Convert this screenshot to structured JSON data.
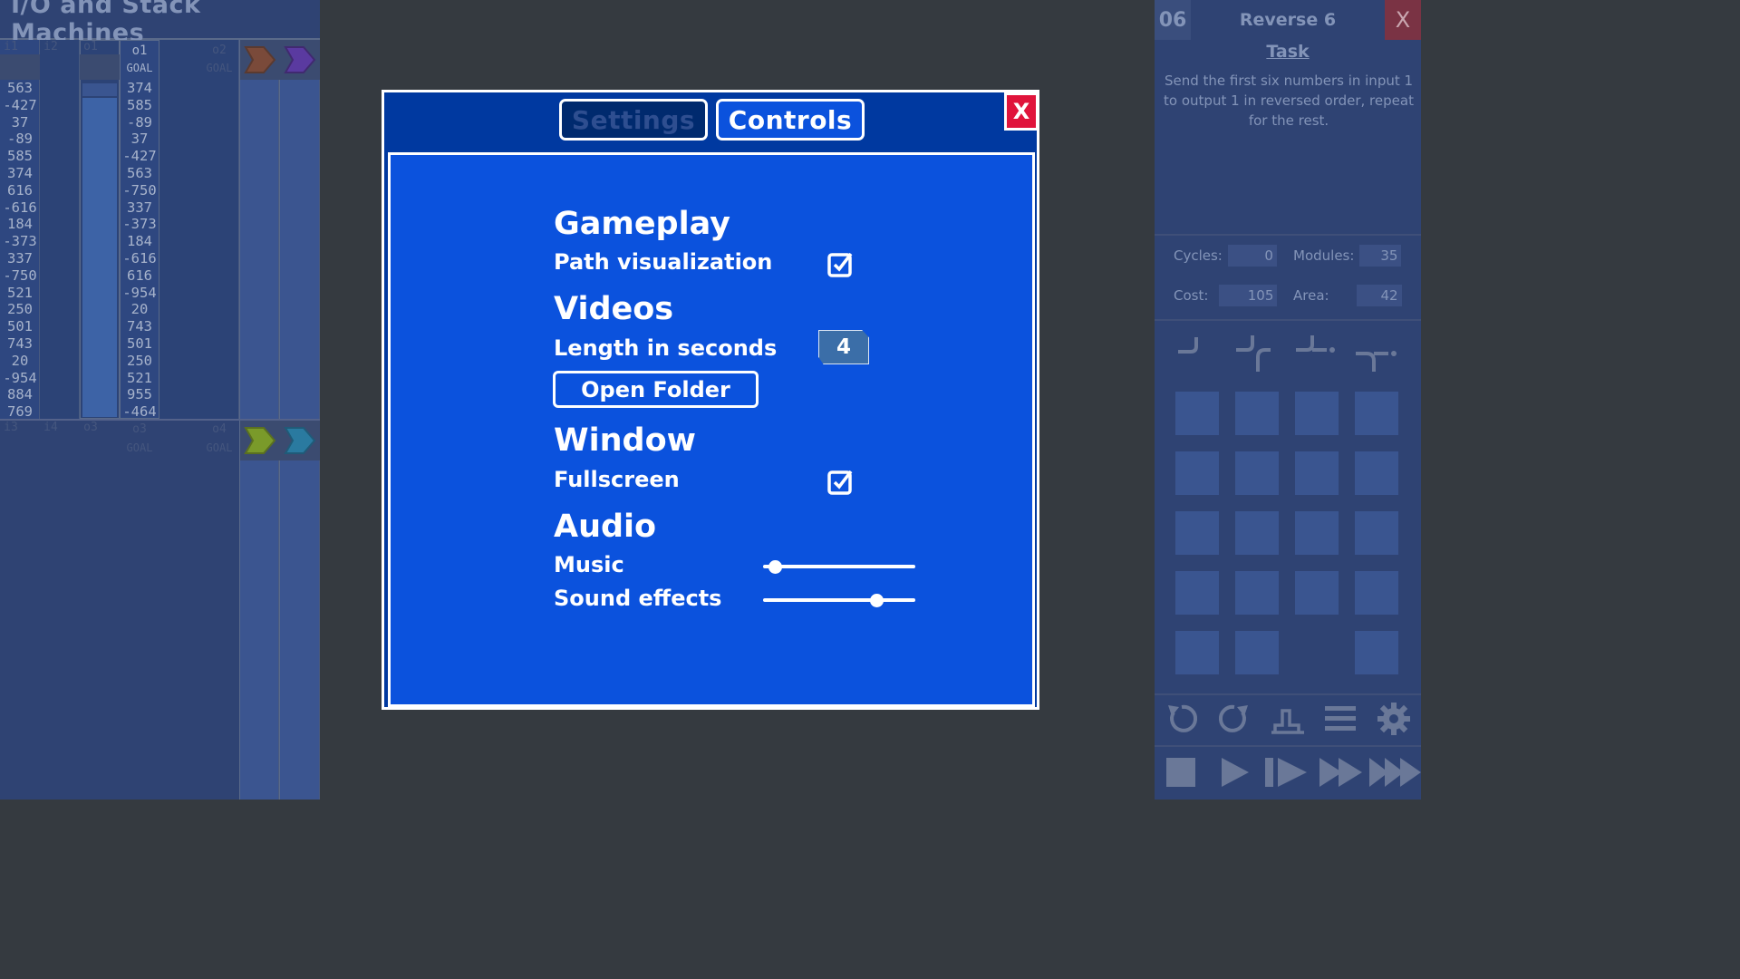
{
  "left_panel": {
    "title": "I/O and Stack Machines",
    "top_headers": [
      {
        "label": "i1",
        "sub": ""
      },
      {
        "label": "i2",
        "sub": ""
      },
      {
        "label": "o1",
        "sub": ""
      },
      {
        "label": "o1",
        "sub": "GOAL"
      },
      {
        "label": "o2",
        "sub": "GOAL"
      }
    ],
    "bottom_headers": [
      {
        "label": "i3",
        "sub": ""
      },
      {
        "label": "i4",
        "sub": ""
      },
      {
        "label": "o3",
        "sub": ""
      },
      {
        "label": "o3",
        "sub": "GOAL"
      },
      {
        "label": "o4",
        "sub": "GOAL"
      }
    ],
    "input1": [
      "563",
      "-427",
      "37",
      "-89",
      "585",
      "374",
      "616",
      "-616",
      "184",
      "-373",
      "337",
      "-750",
      "521",
      "250",
      "501",
      "743",
      "20",
      "-954",
      "884",
      "769"
    ],
    "goal1": [
      "374",
      "585",
      "-89",
      "37",
      "-427",
      "563",
      "-750",
      "337",
      "-373",
      "184",
      "-616",
      "616",
      "-954",
      "20",
      "743",
      "501",
      "250",
      "521",
      "955",
      "-464"
    ],
    "arrow_colors": [
      "#7a4a3a",
      "#5a3aa0",
      "#7a9a2a",
      "#2a7aa0"
    ]
  },
  "level": {
    "number": "06",
    "name": "Reverse 6",
    "close_label": "X",
    "task_title": "Task",
    "task_text": "Send the first six numbers in input 1 to output 1 in reversed order, repeat for the rest."
  },
  "stats": {
    "cycles_label": "Cycles:",
    "cycles": "0",
    "modules_label": "Modules:",
    "modules": "35",
    "cost_label": "Cost:",
    "cost": "105",
    "area_label": "Area:",
    "area": "42"
  },
  "modal": {
    "tab_settings": "Settings",
    "tab_controls": "Controls",
    "close_label": "X",
    "gameplay_title": "Gameplay",
    "path_visualization": "Path visualization",
    "path_visualization_checked": true,
    "videos_title": "Videos",
    "length_label": "Length in seconds",
    "length_value": "4",
    "open_folder": "Open Folder",
    "window_title": "Window",
    "fullscreen_label": "Fullscreen",
    "fullscreen_checked": true,
    "audio_title": "Audio",
    "music_label": "Music",
    "music_level": 0.04,
    "sfx_label": "Sound effects",
    "sfx_level": 0.77
  },
  "colors": {
    "modal_bg": "#0b52dd",
    "modal_header": "#0039a0",
    "close_red": "#e0143b",
    "dim_panel": "#2f4373"
  }
}
